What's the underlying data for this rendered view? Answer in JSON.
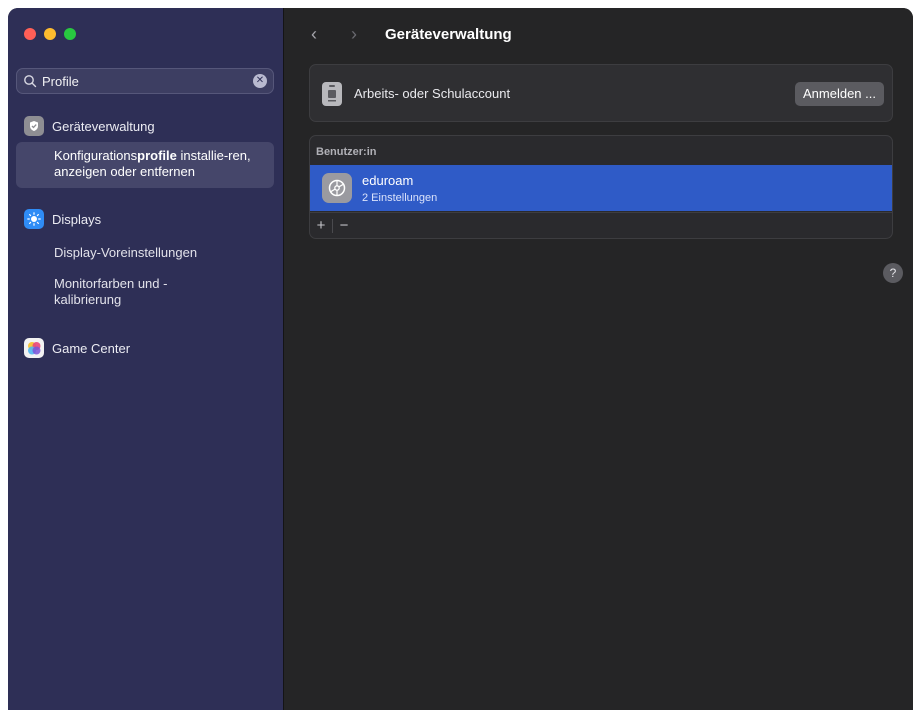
{
  "window": {
    "traffic_lights": {
      "close": "#ff5f57",
      "minimize": "#febc2e",
      "zoom": "#28c840"
    }
  },
  "sidebar": {
    "search": {
      "value": "Profile",
      "icon": "search-icon",
      "clear_icon": "clear-icon"
    },
    "categories": [
      {
        "label": "Geräteverwaltung",
        "icon": "device-management-icon",
        "color": "#8e8e93"
      },
      {
        "label": "Displays",
        "icon": "displays-icon",
        "color": "#2f8cf6"
      },
      {
        "label": "Game Center",
        "icon": "game-center-icon",
        "color": "#f2f2f2"
      }
    ],
    "selected_result": {
      "before": "Konfigurations",
      "highlight": "profile",
      "after": " installie-ren, anzeigen oder entfernen"
    },
    "results": {
      "display_presets": "Display-Voreinstellungen",
      "monitor_colors": "Monitorfarben und -kalibrierung"
    }
  },
  "toolbar": {
    "title": "Geräteverwaltung",
    "back_icon": "chevron-left-icon",
    "forward_icon": "chevron-right-icon"
  },
  "work_account": {
    "label": "Arbeits- oder Schulaccount",
    "button": "Anmelden ..."
  },
  "profiles": {
    "header": "Benutzer:in",
    "rows": [
      {
        "name": "eduroam",
        "detail": "2 Einstellungen",
        "icon": "gear-icon"
      }
    ],
    "add": "+",
    "remove": "−"
  },
  "help": "?",
  "colors": {
    "accent": "#2f5bc7",
    "sidebar": "#2e2f56",
    "content": "#252526"
  }
}
